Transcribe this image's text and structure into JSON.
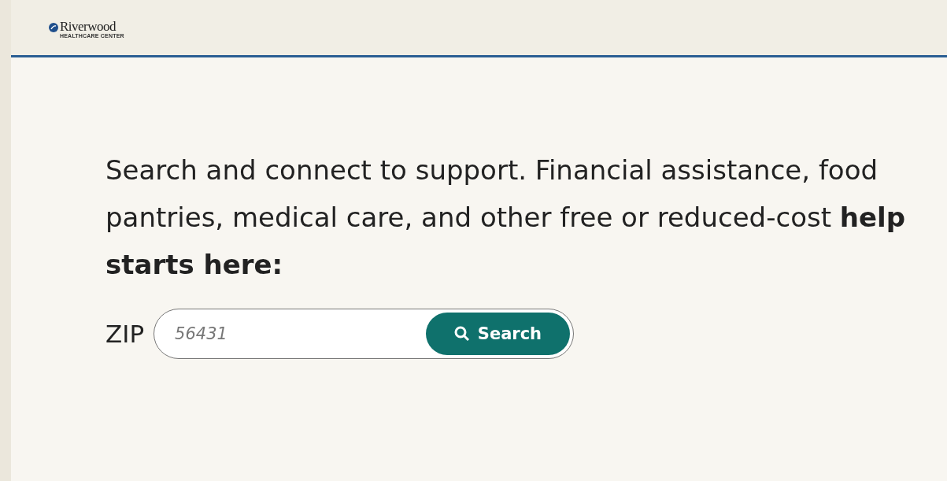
{
  "header": {
    "logo_name": "Riverwood",
    "logo_subtitle": "HEALTHCARE CENTER"
  },
  "intro": "Search and connect to support. Financial assistance, food pantries, medical care, and other free or reduced-cost **help starts here:**",
  "zip_search": {
    "label": "ZIP",
    "placeholder": "56431",
    "button": "Search"
  }
}
